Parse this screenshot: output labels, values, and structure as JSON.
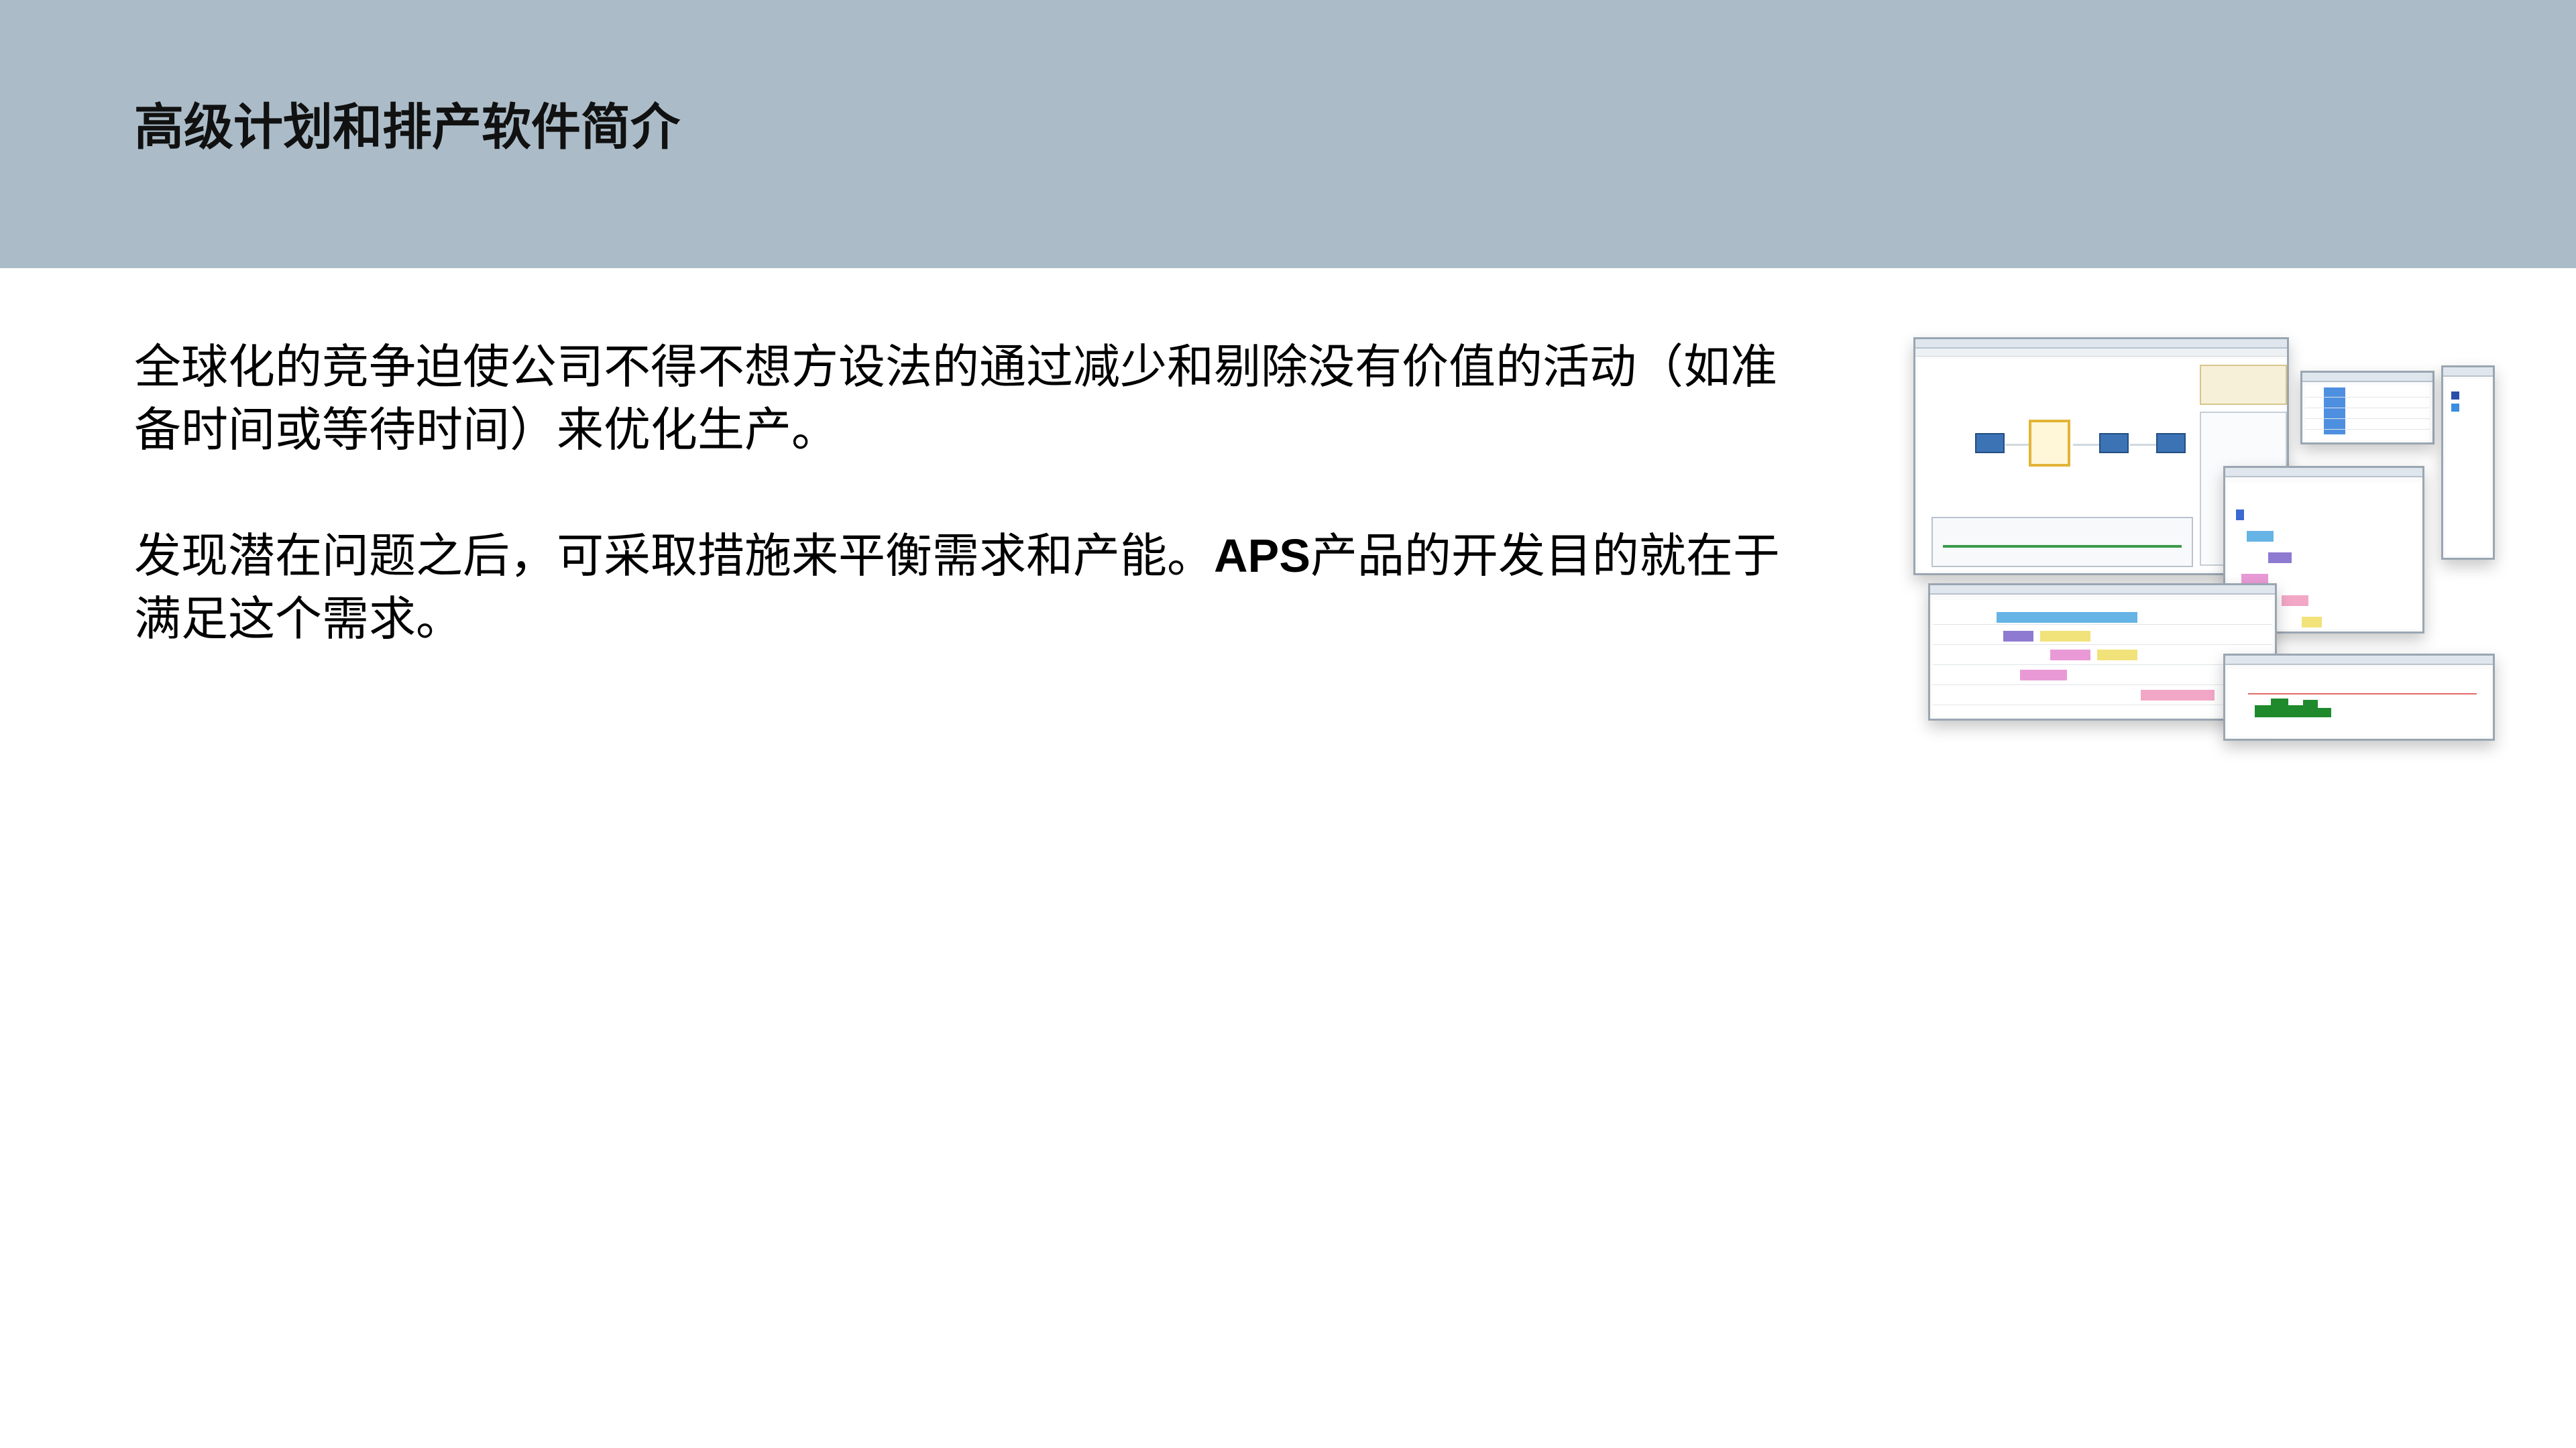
{
  "header": {
    "title": "高级计划和排产软件简介"
  },
  "content": {
    "paragraph_1": "全球化的竞争迫使公司不得不想方设法的通过减少和剔除没有价值的活动（如准备时间或等待时间）来优化生产。",
    "paragraph_2_before": "发现潜在问题之后，可采取措施来平衡需求和产能。",
    "paragraph_2_bold": "APS",
    "paragraph_2_after": "产品的开发目的就在于满足这个需求。"
  },
  "colors": {
    "header_band": "#abbcc8",
    "gantt_blue": "#66b3e6",
    "gantt_pink": "#e99ad6",
    "gantt_yellow": "#f2e27a",
    "gantt_purple": "#8e7ad1",
    "histogram_green": "#1f8a2c"
  },
  "screenshot": {
    "description_icon": "aps-software-screenshot"
  }
}
